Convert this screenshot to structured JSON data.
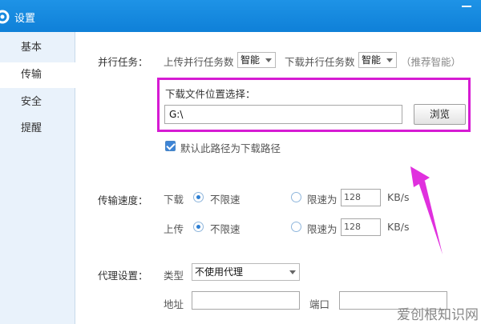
{
  "window": {
    "title": "设置"
  },
  "sidebar": {
    "items": [
      {
        "label": "基本"
      },
      {
        "label": "传输",
        "active": true
      },
      {
        "label": "安全"
      },
      {
        "label": "提醒"
      }
    ]
  },
  "parallel": {
    "section_label": "并行任务：",
    "upload_label": "上传并行任务数",
    "upload_value": "智能",
    "download_label": "下载并行任务数",
    "download_value": "智能",
    "recommend_hint": "（推荐智能）"
  },
  "download_location": {
    "label": "下载文件位置选择：",
    "path_value": "G:\\",
    "browse_label": "浏览",
    "default_checkbox_label": "默认此路径为下载路径",
    "default_checked": true
  },
  "speed": {
    "section_label": "传输速度：",
    "download_label": "下载",
    "upload_label": "上传",
    "unlimited_label": "不限速",
    "limit_label": "限速为",
    "download_limit_value": "128",
    "upload_limit_value": "128",
    "unit": "KB/s",
    "download_mode": "unlimited",
    "upload_mode": "unlimited"
  },
  "proxy": {
    "section_label": "代理设置：",
    "type_label": "类型",
    "type_value": "不使用代理",
    "address_label": "地址",
    "port_label": "端口",
    "address_value": "",
    "port_value": ""
  },
  "watermark": {
    "text": "爱创根知识网"
  },
  "colors": {
    "titlebar": "#1589e0",
    "highlight": "#d61bd3",
    "sidebar_bg": "#e9f2fb"
  }
}
